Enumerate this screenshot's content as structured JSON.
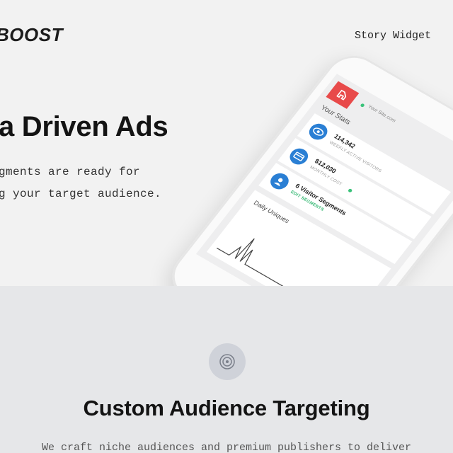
{
  "header": {
    "logo_text": "BOOST",
    "nav_link": "Story Widget"
  },
  "hero": {
    "headline": "a Driven Ads",
    "subline_1": "gments are ready for",
    "subline_2": "g your target audience."
  },
  "phone": {
    "site_label": "Your Site.com",
    "stats_title": "Your Stats",
    "cards": [
      {
        "value": "114,342",
        "caption": "WEEKLY ACTIVE VISITORS",
        "icon": "eye-icon"
      },
      {
        "value": "$12,030",
        "caption": "MONTHLY COST",
        "icon": "credit-card-icon"
      },
      {
        "value": "6 Visitor Segments",
        "caption": "EDIT SEGMENTS",
        "icon": "user-icon"
      }
    ],
    "daily_title": "Daily Uniques"
  },
  "feature": {
    "icon": "target-icon",
    "title": "Custom Audience Targeting",
    "description": "We craft niche audiences and premium publishers to deliver"
  },
  "colors": {
    "accent_red": "#e84a4a",
    "accent_blue": "#2a7fd4",
    "accent_green": "#35b873",
    "section_bg": "#e6e7e9"
  }
}
